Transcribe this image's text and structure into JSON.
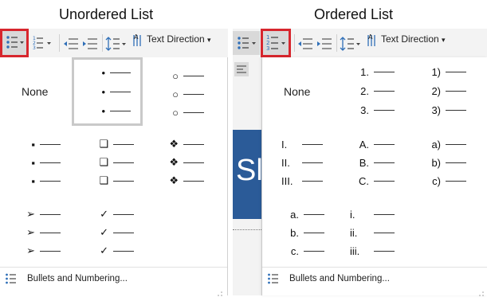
{
  "headings": {
    "unordered": "Unordered List",
    "ordered": "Ordered List"
  },
  "toolbar": {
    "text_direction": "Text Direction",
    "dropdown_arrow": "▾"
  },
  "background_slide": {
    "partial_text": "Sli"
  },
  "unordered_panel": {
    "none_label": "None",
    "bullet_styles": [
      {
        "name": "filled-round-bullet",
        "glyph": "•"
      },
      {
        "name": "hollow-round-bullet",
        "glyph": "○"
      },
      {
        "name": "filled-square-bullet",
        "glyph": "▪"
      },
      {
        "name": "hollow-square-bullet",
        "glyph": "❑"
      },
      {
        "name": "star-diamond-bullet",
        "glyph": "❖"
      },
      {
        "name": "arrow-bullet",
        "glyph": "➢"
      },
      {
        "name": "checkmark-bullet",
        "glyph": "✓"
      }
    ],
    "selected_style": "filled-round-bullet",
    "footer_label": "Bullets and Numbering..."
  },
  "ordered_panel": {
    "none_label": "None",
    "numbering_styles": [
      {
        "name": "arabic-period",
        "markers": [
          "1.",
          "2.",
          "3."
        ]
      },
      {
        "name": "arabic-paren",
        "markers": [
          "1)",
          "2)",
          "3)"
        ]
      },
      {
        "name": "roman-upper",
        "markers": [
          "I.",
          "II.",
          "III."
        ]
      },
      {
        "name": "alpha-upper",
        "markers": [
          "A.",
          "B.",
          "C."
        ]
      },
      {
        "name": "alpha-lower-paren",
        "markers": [
          "a)",
          "b)",
          "c)"
        ]
      },
      {
        "name": "alpha-lower-period",
        "markers": [
          "a.",
          "b.",
          "c."
        ]
      },
      {
        "name": "roman-lower",
        "markers": [
          "i.",
          "ii.",
          "iii."
        ]
      }
    ],
    "footer_label": "Bullets and Numbering..."
  },
  "colors": {
    "highlight_red": "#d7262d",
    "selected_gray": "#c9c9c9",
    "slide_blue": "#2b5b98"
  }
}
